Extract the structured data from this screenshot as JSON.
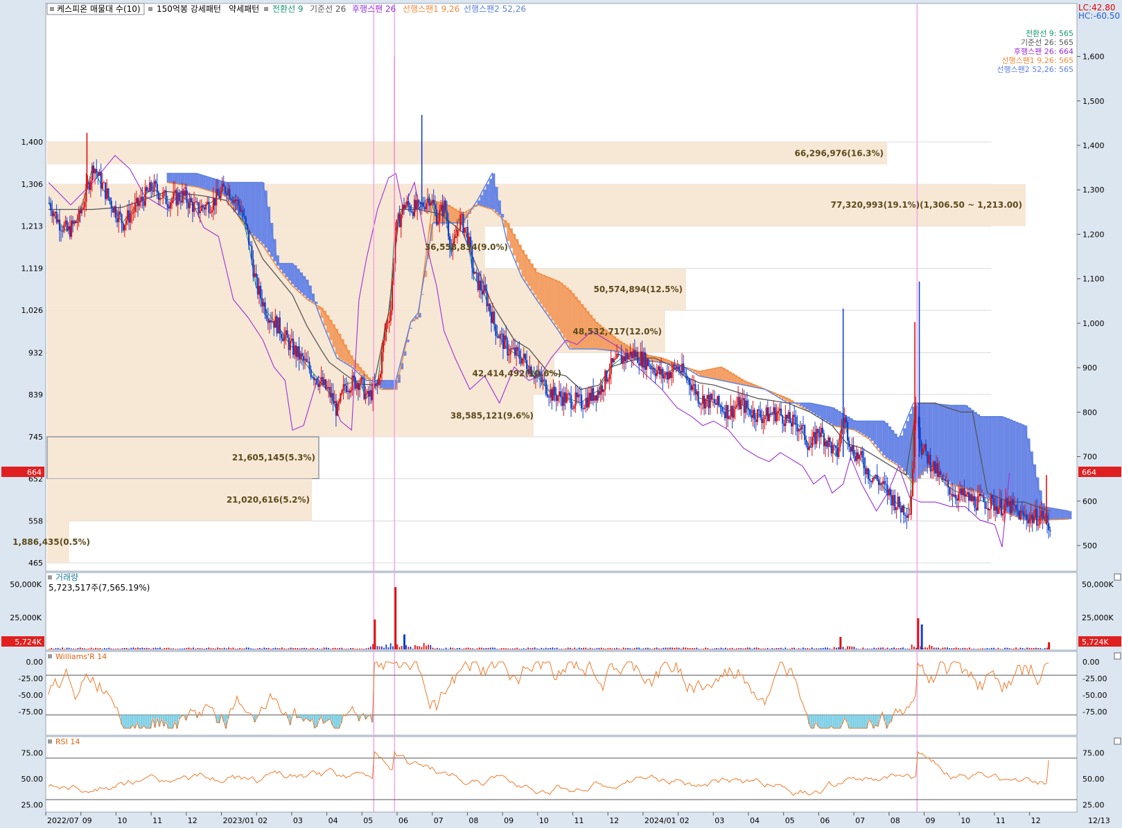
{
  "header": {
    "items": [
      {
        "text": "케스피온 매물대 수(10)",
        "color": "#000000"
      },
      {
        "text": "150억봉 강세패턴",
        "color": "#000000"
      },
      {
        "text": "약세패턴",
        "color": "#000000"
      },
      {
        "text": "전환선 9",
        "color": "#15966f"
      },
      {
        "text": "기준선 26",
        "color": "#555555"
      },
      {
        "text": "후행스팬 26",
        "color": "#9b30d9"
      },
      {
        "text": "선행스팬1 9,26",
        "color": "#f08a3c"
      },
      {
        "text": "선행스팬2 52,26",
        "color": "#5a7fe0"
      }
    ],
    "lc": "LC:42.80",
    "hc": "HC:-60.50"
  },
  "legend_values": [
    {
      "text": "전환선 9: 565",
      "color": "#15966f"
    },
    {
      "text": "기준선 26: 565",
      "color": "#555555"
    },
    {
      "text": "후행스팬 26: 664",
      "color": "#9b30d9"
    },
    {
      "text": "선행스팬1 9,26: 565",
      "color": "#f08a3c"
    },
    {
      "text": "선행스팬2 52,26: 565",
      "color": "#5a7fe0"
    }
  ],
  "price_badge": "664",
  "volume": {
    "title": "거래량",
    "subtitle": "5,723,517주(7,565.19%)",
    "badge": "5,724K",
    "left_ticks": [
      "50,000K",
      "25,000K"
    ],
    "right_ticks": [
      "50,000K",
      "25,000K"
    ]
  },
  "williams": {
    "title": "Williams'R 14",
    "ticks": [
      "0.00",
      "-25.00",
      "-50.00",
      "-75.00"
    ]
  },
  "rsi": {
    "title": "RSI 14",
    "ticks": [
      "75.00",
      "50.00",
      "25.00"
    ]
  },
  "x_ticks": [
    "2022/07",
    "09",
    "10",
    "11",
    "12",
    "2023/01",
    "02",
    "03",
    "04",
    "05",
    "06",
    "07",
    "08",
    "09",
    "10",
    "11",
    "12",
    "2024/01",
    "02",
    "03",
    "04",
    "05",
    "06",
    "07",
    "08",
    "09",
    "10",
    "11",
    "12"
  ],
  "x_end_label": "12/13",
  "chart_data": {
    "type": "candlestick",
    "left_ticks": [
      "1,400",
      "1,306",
      "1,213",
      "1,119",
      "1,026",
      "932",
      "839",
      "745",
      "652",
      "558",
      "465"
    ],
    "right_ticks": [
      "1,600",
      "1,500",
      "1,400",
      "1,300",
      "1,200",
      "1,100",
      "1,000",
      "900",
      "800",
      "700",
      "600",
      "500"
    ],
    "volume_profile": [
      {
        "label": "66,296,976(16.3%)",
        "lo": 1350,
        "hi": 1400
      },
      {
        "label": "77,320,993(19.1%)(1,306.50 ~ 1,213.00)",
        "lo": 1213,
        "hi": 1306.5
      },
      {
        "label": "36,558,834(9.0%)",
        "lo": 1119,
        "hi": 1213
      },
      {
        "label": "50,574,894(12.5%)",
        "lo": 1026,
        "hi": 1119
      },
      {
        "label": "48,532,717(12.0%)",
        "lo": 932,
        "hi": 1026
      },
      {
        "label": "42,414,492(10.6%)",
        "lo": 839,
        "hi": 932
      },
      {
        "label": "38,585,121(9.6%)",
        "lo": 745,
        "hi": 839
      },
      {
        "label": "21,605,145(5.3%)",
        "lo": 652,
        "hi": 745
      },
      {
        "label": "21,020,616(5.2%)",
        "lo": 558,
        "hi": 652
      },
      {
        "label": "1,886,435(0.5%)",
        "lo": 465,
        "hi": 558
      }
    ],
    "close_path": [
      [
        0,
        1265
      ],
      [
        12,
        1225
      ],
      [
        25,
        1200
      ],
      [
        40,
        1230
      ],
      [
        52,
        1300
      ],
      [
        60,
        1350
      ],
      [
        70,
        1310
      ],
      [
        85,
        1260
      ],
      [
        100,
        1220
      ],
      [
        120,
        1260
      ],
      [
        140,
        1300
      ],
      [
        160,
        1270
      ],
      [
        180,
        1280
      ],
      [
        200,
        1250
      ],
      [
        220,
        1265
      ],
      [
        240,
        1300
      ],
      [
        260,
        1250
      ],
      [
        270,
        1180
      ],
      [
        280,
        1080
      ],
      [
        295,
        1020
      ],
      [
        310,
        990
      ],
      [
        325,
        950
      ],
      [
        340,
        920
      ],
      [
        360,
        880
      ],
      [
        380,
        840
      ],
      [
        390,
        800
      ],
      [
        400,
        860
      ],
      [
        420,
        870
      ],
      [
        430,
        830
      ],
      [
        445,
        860
      ],
      [
        455,
        990
      ],
      [
        462,
        1030
      ],
      [
        468,
        1200
      ],
      [
        480,
        1260
      ],
      [
        500,
        1250
      ],
      [
        515,
        1280
      ],
      [
        525,
        1230
      ],
      [
        535,
        1260
      ],
      [
        545,
        1150
      ],
      [
        555,
        1230
      ],
      [
        565,
        1200
      ],
      [
        575,
        1100
      ],
      [
        590,
        1060
      ],
      [
        605,
        980
      ],
      [
        620,
        940
      ],
      [
        640,
        920
      ],
      [
        660,
        880
      ],
      [
        680,
        840
      ],
      [
        700,
        830
      ],
      [
        720,
        820
      ],
      [
        745,
        850
      ],
      [
        760,
        900
      ],
      [
        775,
        920
      ],
      [
        790,
        930
      ],
      [
        810,
        910
      ],
      [
        830,
        880
      ],
      [
        850,
        900
      ],
      [
        870,
        860
      ],
      [
        880,
        830
      ],
      [
        900,
        820
      ],
      [
        920,
        800
      ],
      [
        935,
        820
      ],
      [
        950,
        800
      ],
      [
        965,
        790
      ],
      [
        985,
        800
      ],
      [
        1000,
        780
      ],
      [
        1015,
        770
      ],
      [
        1030,
        720
      ],
      [
        1040,
        760
      ],
      [
        1055,
        730
      ],
      [
        1065,
        700
      ],
      [
        1075,
        790
      ],
      [
        1085,
        720
      ],
      [
        1100,
        690
      ],
      [
        1110,
        660
      ],
      [
        1120,
        650
      ],
      [
        1135,
        620
      ],
      [
        1150,
        590
      ],
      [
        1165,
        580
      ],
      [
        1172,
        830
      ],
      [
        1180,
        720
      ],
      [
        1195,
        680
      ],
      [
        1210,
        640
      ],
      [
        1225,
        620
      ],
      [
        1240,
        610
      ],
      [
        1255,
        600
      ],
      [
        1270,
        600
      ],
      [
        1285,
        590
      ],
      [
        1300,
        590
      ],
      [
        1315,
        570
      ],
      [
        1330,
        565
      ],
      [
        1345,
        570
      ],
      [
        1350,
        550
      ],
      [
        1355,
        542
      ]
    ],
    "kijun_path": [
      [
        0,
        1250
      ],
      [
        60,
        1250
      ],
      [
        100,
        1255
      ],
      [
        160,
        1290
      ],
      [
        210,
        1280
      ],
      [
        240,
        1270
      ],
      [
        270,
        1210
      ],
      [
        290,
        1140
      ],
      [
        310,
        1100
      ],
      [
        330,
        1060
      ],
      [
        350,
        990
      ],
      [
        370,
        935
      ],
      [
        380,
        910
      ],
      [
        400,
        885
      ],
      [
        420,
        862
      ],
      [
        440,
        860
      ],
      [
        460,
        1020
      ],
      [
        475,
        1250
      ],
      [
        500,
        1250
      ],
      [
        530,
        1240
      ],
      [
        560,
        1200
      ],
      [
        580,
        1120
      ],
      [
        600,
        1040
      ],
      [
        615,
        1000
      ],
      [
        630,
        960
      ],
      [
        650,
        940
      ],
      [
        675,
        890
      ],
      [
        700,
        880
      ],
      [
        720,
        850
      ],
      [
        745,
        860
      ],
      [
        760,
        900
      ],
      [
        780,
        910
      ],
      [
        800,
        920
      ],
      [
        820,
        920
      ],
      [
        840,
        905
      ],
      [
        860,
        880
      ],
      [
        880,
        865
      ],
      [
        900,
        860
      ],
      [
        920,
        850
      ],
      [
        940,
        840
      ],
      [
        960,
        830
      ],
      [
        980,
        825
      ],
      [
        1000,
        820
      ],
      [
        1030,
        800
      ],
      [
        1060,
        770
      ],
      [
        1080,
        730
      ],
      [
        1100,
        720
      ],
      [
        1120,
        700
      ],
      [
        1140,
        680
      ],
      [
        1160,
        660
      ],
      [
        1175,
        820
      ],
      [
        1200,
        820
      ],
      [
        1215,
        810
      ],
      [
        1235,
        800
      ],
      [
        1250,
        800
      ],
      [
        1270,
        620
      ],
      [
        1300,
        600
      ],
      [
        1320,
        600
      ],
      [
        1355,
        580
      ]
    ],
    "chikou_path": [
      [
        0,
        1310
      ],
      [
        30,
        1260
      ],
      [
        60,
        1310
      ],
      [
        90,
        1370
      ],
      [
        110,
        1340
      ],
      [
        130,
        1280
      ],
      [
        160,
        1250
      ],
      [
        185,
        1300
      ],
      [
        210,
        1210
      ],
      [
        230,
        1190
      ],
      [
        250,
        1050
      ],
      [
        270,
        1010
      ],
      [
        290,
        960
      ],
      [
        305,
        900
      ],
      [
        320,
        870
      ],
      [
        330,
        760
      ],
      [
        345,
        770
      ],
      [
        365,
        880
      ],
      [
        380,
        850
      ],
      [
        395,
        780
      ],
      [
        410,
        760
      ],
      [
        420,
        1050
      ],
      [
        430,
        1140
      ],
      [
        445,
        1250
      ],
      [
        460,
        1320
      ],
      [
        470,
        1330
      ],
      [
        480,
        1250
      ],
      [
        495,
        1310
      ],
      [
        510,
        1180
      ],
      [
        525,
        1080
      ],
      [
        535,
        980
      ],
      [
        550,
        920
      ],
      [
        570,
        850
      ],
      [
        590,
        880
      ],
      [
        610,
        820
      ],
      [
        630,
        900
      ],
      [
        650,
        870
      ],
      [
        665,
        880
      ],
      [
        680,
        920
      ],
      [
        700,
        960
      ],
      [
        715,
        950
      ],
      [
        735,
        980
      ],
      [
        755,
        960
      ],
      [
        775,
        940
      ],
      [
        790,
        910
      ],
      [
        810,
        880
      ],
      [
        830,
        850
      ],
      [
        850,
        810
      ],
      [
        870,
        790
      ],
      [
        885,
        770
      ],
      [
        900,
        780
      ],
      [
        920,
        760
      ],
      [
        940,
        720
      ],
      [
        960,
        700
      ],
      [
        975,
        690
      ],
      [
        990,
        710
      ],
      [
        1000,
        700
      ],
      [
        1020,
        680
      ],
      [
        1035,
        640
      ],
      [
        1050,
        660
      ],
      [
        1060,
        620
      ],
      [
        1075,
        640
      ],
      [
        1085,
        700
      ],
      [
        1100,
        640
      ],
      [
        1110,
        610
      ],
      [
        1120,
        580
      ],
      [
        1135,
        620
      ],
      [
        1150,
        680
      ],
      [
        1165,
        610
      ],
      [
        1180,
        600
      ],
      [
        1200,
        600
      ],
      [
        1220,
        590
      ],
      [
        1240,
        590
      ],
      [
        1260,
        560
      ],
      [
        1280,
        550
      ],
      [
        1290,
        500
      ],
      [
        1300,
        665
      ]
    ],
    "span_a": [
      [
        160,
        1310
      ],
      [
        200,
        1300
      ],
      [
        240,
        1280
      ],
      [
        270,
        1200
      ],
      [
        290,
        1170
      ],
      [
        310,
        1120
      ],
      [
        330,
        1080
      ],
      [
        350,
        1050
      ],
      [
        370,
        1030
      ],
      [
        390,
        980
      ],
      [
        410,
        920
      ],
      [
        430,
        880
      ],
      [
        450,
        850
      ],
      [
        470,
        850
      ],
      [
        490,
        1000
      ],
      [
        500,
        1010
      ],
      [
        520,
        1270
      ],
      [
        540,
        1260
      ],
      [
        560,
        1240
      ],
      [
        580,
        1260
      ],
      [
        600,
        1250
      ],
      [
        620,
        1220
      ],
      [
        640,
        1160
      ],
      [
        660,
        1110
      ],
      [
        690,
        1090
      ],
      [
        705,
        1070
      ],
      [
        740,
        1000
      ],
      [
        770,
        960
      ],
      [
        800,
        930
      ],
      [
        830,
        920
      ],
      [
        860,
        900
      ],
      [
        880,
        890
      ],
      [
        910,
        900
      ],
      [
        940,
        870
      ],
      [
        970,
        850
      ],
      [
        1000,
        830
      ],
      [
        1030,
        800
      ],
      [
        1060,
        770
      ],
      [
        1090,
        760
      ],
      [
        1110,
        740
      ],
      [
        1130,
        700
      ],
      [
        1150,
        680
      ],
      [
        1170,
        640
      ],
      [
        1190,
        680
      ],
      [
        1220,
        640
      ],
      [
        1240,
        630
      ],
      [
        1260,
        620
      ],
      [
        1290,
        580
      ],
      [
        1320,
        560
      ],
      [
        1345,
        560
      ],
      [
        1380,
        562
      ]
    ],
    "span_b": [
      [
        160,
        1330
      ],
      [
        200,
        1330
      ],
      [
        240,
        1310
      ],
      [
        270,
        1310
      ],
      [
        290,
        1310
      ],
      [
        310,
        1130
      ],
      [
        330,
        1130
      ],
      [
        350,
        1090
      ],
      [
        370,
        1000
      ],
      [
        390,
        920
      ],
      [
        410,
        900
      ],
      [
        430,
        870
      ],
      [
        450,
        870
      ],
      [
        470,
        870
      ],
      [
        490,
        1000
      ],
      [
        500,
        1020
      ],
      [
        520,
        1220
      ],
      [
        540,
        1220
      ],
      [
        560,
        1220
      ],
      [
        580,
        1270
      ],
      [
        600,
        1330
      ],
      [
        620,
        1180
      ],
      [
        640,
        1100
      ],
      [
        660,
        1050
      ],
      [
        690,
        980
      ],
      [
        705,
        940
      ],
      [
        740,
        940
      ],
      [
        770,
        935
      ],
      [
        800,
        915
      ],
      [
        830,
        910
      ],
      [
        860,
        900
      ],
      [
        880,
        880
      ],
      [
        910,
        870
      ],
      [
        940,
        860
      ],
      [
        970,
        850
      ],
      [
        1000,
        820
      ],
      [
        1030,
        820
      ],
      [
        1060,
        810
      ],
      [
        1090,
        780
      ],
      [
        1110,
        780
      ],
      [
        1130,
        780
      ],
      [
        1150,
        740
      ],
      [
        1170,
        820
      ],
      [
        1190,
        820
      ],
      [
        1220,
        815
      ],
      [
        1240,
        815
      ],
      [
        1260,
        790
      ],
      [
        1290,
        790
      ],
      [
        1320,
        770
      ],
      [
        1345,
        590
      ],
      [
        1380,
        580
      ]
    ]
  }
}
